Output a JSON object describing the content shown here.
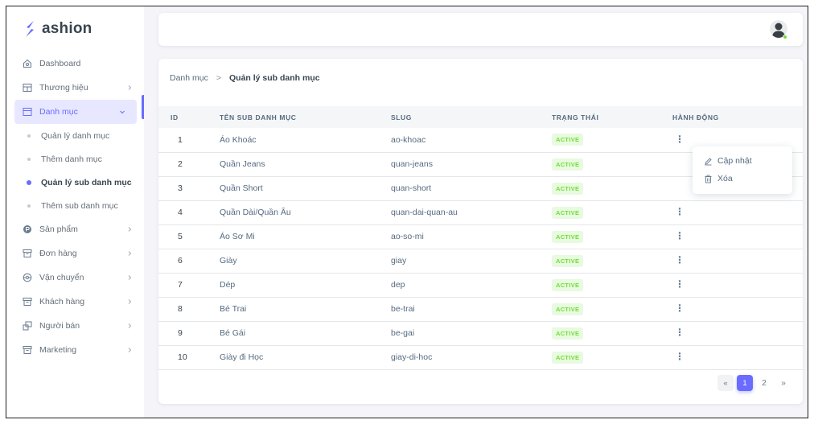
{
  "brand": {
    "name": "ashion",
    "color": "#696cff"
  },
  "sidebar": {
    "items": [
      {
        "label": "Dashboard",
        "icon": "home-icon"
      },
      {
        "label": "Thương hiệu",
        "icon": "table-icon"
      },
      {
        "label": "Danh mục",
        "icon": "folder-icon",
        "active": true
      },
      {
        "label": "Sản phẩm",
        "icon": "product-icon"
      },
      {
        "label": "Đơn hàng",
        "icon": "box-icon"
      },
      {
        "label": "Vận chuyển",
        "icon": "shipping-icon"
      },
      {
        "label": "Khách hàng",
        "icon": "box-icon"
      },
      {
        "label": "Người bán",
        "icon": "seller-icon"
      },
      {
        "label": "Marketing",
        "icon": "box-icon"
      }
    ],
    "submenu": [
      {
        "label": "Quản lý danh mục"
      },
      {
        "label": "Thêm danh mục"
      },
      {
        "label": "Quản lý sub danh mục",
        "current": true
      },
      {
        "label": "Thêm sub danh mục"
      }
    ]
  },
  "navbar": {
    "avatar": "user-avatar",
    "status_color": "#71dd37"
  },
  "breadcrumb": {
    "parent": "Danh mục",
    "separator": ">",
    "current": "Quản lý sub danh mục"
  },
  "table": {
    "headers": {
      "id": "ID",
      "name": "TÊN SUB DANH MỤC",
      "slug": "SLUG",
      "status": "TRẠNG THÁI",
      "action": "HÀNH ĐỘNG"
    },
    "rows": [
      {
        "id": "1",
        "name": "Áo Khoác",
        "slug": "ao-khoac",
        "status": "ACTIVE"
      },
      {
        "id": "2",
        "name": "Quần Jeans",
        "slug": "quan-jeans",
        "status": "ACTIVE"
      },
      {
        "id": "3",
        "name": "Quần Short",
        "slug": "quan-short",
        "status": "ACTIVE"
      },
      {
        "id": "4",
        "name": "Quần Dài/Quần Âu",
        "slug": "quan-dai-quan-au",
        "status": "ACTIVE"
      },
      {
        "id": "5",
        "name": "Áo Sơ Mi",
        "slug": "ao-so-mi",
        "status": "ACTIVE"
      },
      {
        "id": "6",
        "name": "Giày",
        "slug": "giay",
        "status": "ACTIVE"
      },
      {
        "id": "7",
        "name": "Dép",
        "slug": "dep",
        "status": "ACTIVE"
      },
      {
        "id": "8",
        "name": "Bé Trai",
        "slug": "be-trai",
        "status": "ACTIVE"
      },
      {
        "id": "9",
        "name": "Bé Gái",
        "slug": "be-gai",
        "status": "ACTIVE"
      },
      {
        "id": "10",
        "name": "Giày đi Học",
        "slug": "giay-di-hoc",
        "status": "ACTIVE"
      }
    ],
    "status_color": "#71dd37"
  },
  "dropdown": {
    "update_label": "Cập nhật",
    "update_icon": "edit-icon",
    "delete_label": "Xóa",
    "delete_icon": "trash-icon"
  },
  "pagination": {
    "prev": "«",
    "pages": [
      "1",
      "2"
    ],
    "active_page": "1",
    "next": "»"
  }
}
